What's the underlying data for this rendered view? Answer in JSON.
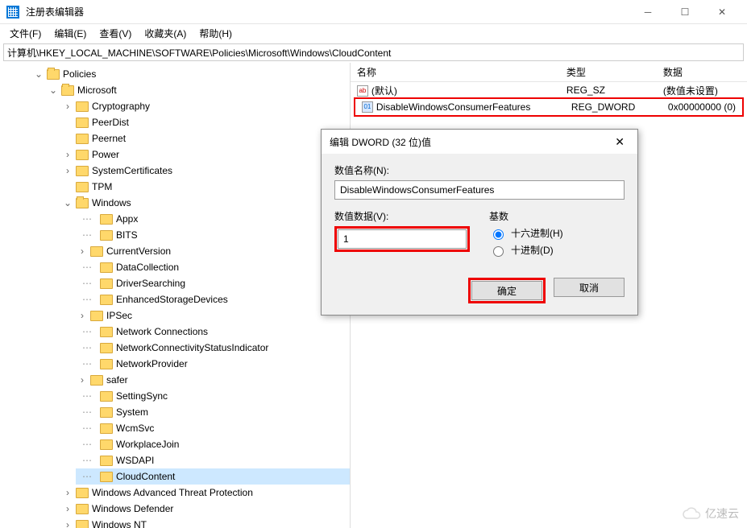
{
  "window": {
    "title": "注册表编辑器"
  },
  "menu": {
    "file": "文件(F)",
    "edit": "编辑(E)",
    "view": "查看(V)",
    "favorites": "收藏夹(A)",
    "help": "帮助(H)"
  },
  "addressbar": "计算机\\HKEY_LOCAL_MACHINE\\SOFTWARE\\Policies\\Microsoft\\Windows\\CloudContent",
  "tree": {
    "policies": "Policies",
    "microsoft": "Microsoft",
    "cryptography": "Cryptography",
    "peerdist": "PeerDist",
    "peernet": "Peernet",
    "power": "Power",
    "systemcertificates": "SystemCertificates",
    "tpm": "TPM",
    "windows": "Windows",
    "appx": "Appx",
    "bits": "BITS",
    "currentversion": "CurrentVersion",
    "datacollection": "DataCollection",
    "driversearching": "DriverSearching",
    "enhancedstorage": "EnhancedStorageDevices",
    "ipsec": "IPSec",
    "netconn": "Network Connections",
    "netconnstatus": "NetworkConnectivityStatusIndicator",
    "netprovider": "NetworkProvider",
    "safer": "safer",
    "settingsync": "SettingSync",
    "system": "System",
    "wcmsvc": "WcmSvc",
    "workplacejoin": "WorkplaceJoin",
    "wsdapi": "WSDAPI",
    "cloudcontent": "CloudContent",
    "watp": "Windows Advanced Threat Protection",
    "defender": "Windows Defender",
    "windowsnt": "Windows NT"
  },
  "list": {
    "headers": {
      "name": "名称",
      "type": "类型",
      "data": "数据"
    },
    "rows": [
      {
        "name": "(默认)",
        "type": "REG_SZ",
        "data": "(数值未设置)",
        "icon": "str"
      },
      {
        "name": "DisableWindowsConsumerFeatures",
        "type": "REG_DWORD",
        "data": "0x00000000 (0)",
        "icon": "dwd"
      }
    ]
  },
  "dialog": {
    "title": "编辑 DWORD (32 位)值",
    "name_label": "数值名称(N):",
    "name_value": "DisableWindowsConsumerFeatures",
    "data_label": "数值数据(V):",
    "data_value": "1",
    "base_label": "基数",
    "hex": "十六进制(H)",
    "dec": "十进制(D)",
    "ok": "确定",
    "cancel": "取消"
  },
  "watermark": "亿速云"
}
